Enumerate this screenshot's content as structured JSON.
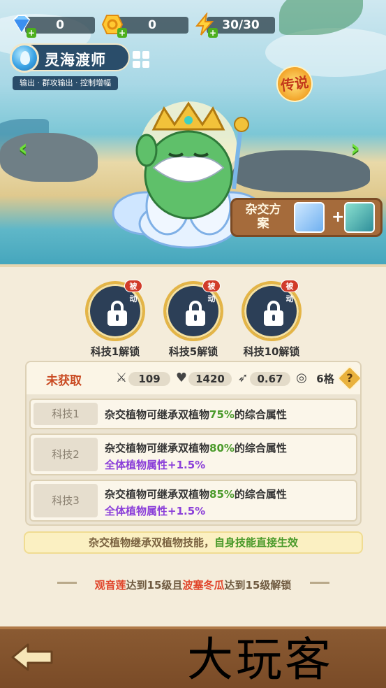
{
  "currencies": [
    {
      "icon": "diamond-icon",
      "value": "0"
    },
    {
      "icon": "coin-icon",
      "value": "0"
    },
    {
      "icon": "energy-icon",
      "value": "30/30"
    }
  ],
  "character": {
    "name": "灵海渡师",
    "tags": "输出 · 群攻输出 · 控制增幅",
    "rarity": "传说"
  },
  "hybrid": {
    "label": "杂交方案"
  },
  "skills": [
    {
      "badge": "被动",
      "label": "科技1解锁"
    },
    {
      "badge": "被动",
      "label": "科技5解锁"
    },
    {
      "badge": "被动",
      "label": "科技10解锁"
    }
  ],
  "stats": {
    "status": "未获取",
    "attack": "109",
    "health": "1420",
    "speed": "0.67",
    "range": "6格",
    "help": "?"
  },
  "techs": [
    {
      "tag": "科技1",
      "line1_pre": "杂交植物可继承双植物",
      "line1_pct": "75%",
      "line1_post": "的综合属性",
      "line2": ""
    },
    {
      "tag": "科技2",
      "line1_pre": "杂交植物可继承双植物",
      "line1_pct": "80%",
      "line1_post": "的综合属性",
      "line2": "全体植物属性+1.5%"
    },
    {
      "tag": "科技3",
      "line1_pre": "杂交植物可继承双植物",
      "line1_pct": "85%",
      "line1_post": "的综合属性",
      "line2": "全体植物属性+1.5%"
    }
  ],
  "note": {
    "pre": "杂交植物继承双植物技能，",
    "highlight": "自身技能直接生效"
  },
  "unlock": {
    "plant1": "观音莲",
    "mid": "达到15级且",
    "plant2": "波塞冬瓜",
    "post": "达到15级解锁"
  },
  "watermark": "大玩客",
  "colors": {
    "accent_green": "#4a9a2a",
    "accent_purple": "#8b3fd9",
    "status_red": "#c94a22",
    "highlight_red": "#e0442a"
  }
}
